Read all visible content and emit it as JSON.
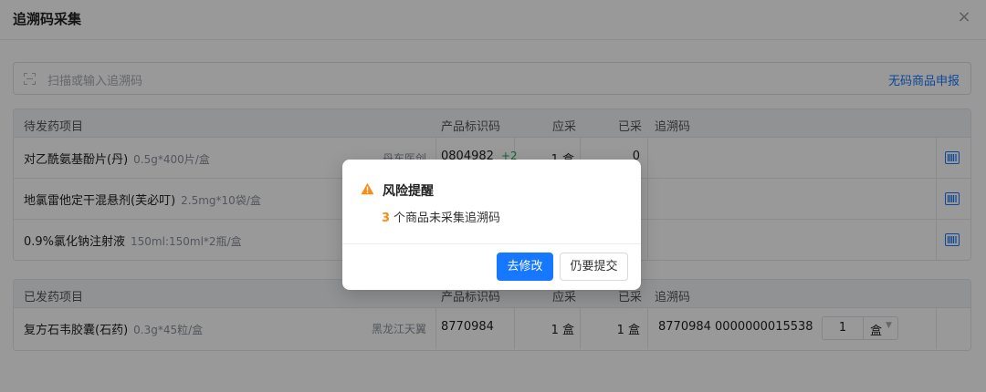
{
  "header": {
    "title": "追溯码采集",
    "close_symbol": "×"
  },
  "search": {
    "placeholder": "扫描或输入追溯码",
    "link": "无码商品申报"
  },
  "pending": {
    "section_title": "待发药项目",
    "columns": {
      "code": "产品标识码",
      "should": "应采",
      "done": "已采",
      "trace": "追溯码"
    },
    "rows": [
      {
        "name": "对乙酰氨基酚片(丹)",
        "spec": "0.5g*400片/盒",
        "maker": "丹东医创",
        "code": "0804982",
        "plus": "+2",
        "should": "1 盒",
        "done": "0"
      },
      {
        "name": "地氯雷他定干混悬剂(芙必叮)",
        "spec": "2.5mg*10袋/盒",
        "maker": "",
        "code": "",
        "plus": "",
        "should": "",
        "done": ""
      },
      {
        "name": "0.9%氯化钠注射液",
        "spec": "150ml:150ml*2瓶/盒",
        "maker": "",
        "code": "",
        "plus": "",
        "should": "",
        "done": ""
      }
    ]
  },
  "dispensed": {
    "section_title": "已发药项目",
    "columns": {
      "code": "产品标识码",
      "should": "应采",
      "done": "已采",
      "trace": "追溯码"
    },
    "rows": [
      {
        "name": "复方石韦胶囊(石药)",
        "spec": "0.3g*45粒/盒",
        "maker": "黑龙江天翼",
        "code": "8770984",
        "should": "1 盒",
        "done": "1 盒",
        "trace": "8770984  0000000015538",
        "qty": "1",
        "unit": "盒"
      }
    ]
  },
  "modal": {
    "title": "风险提醒",
    "count": "3",
    "message": "个商品未采集追溯码",
    "primary_button": "去修改",
    "secondary_button": "仍要提交",
    "warning_color": "#fa8c16",
    "primary_color": "#1677ff"
  }
}
